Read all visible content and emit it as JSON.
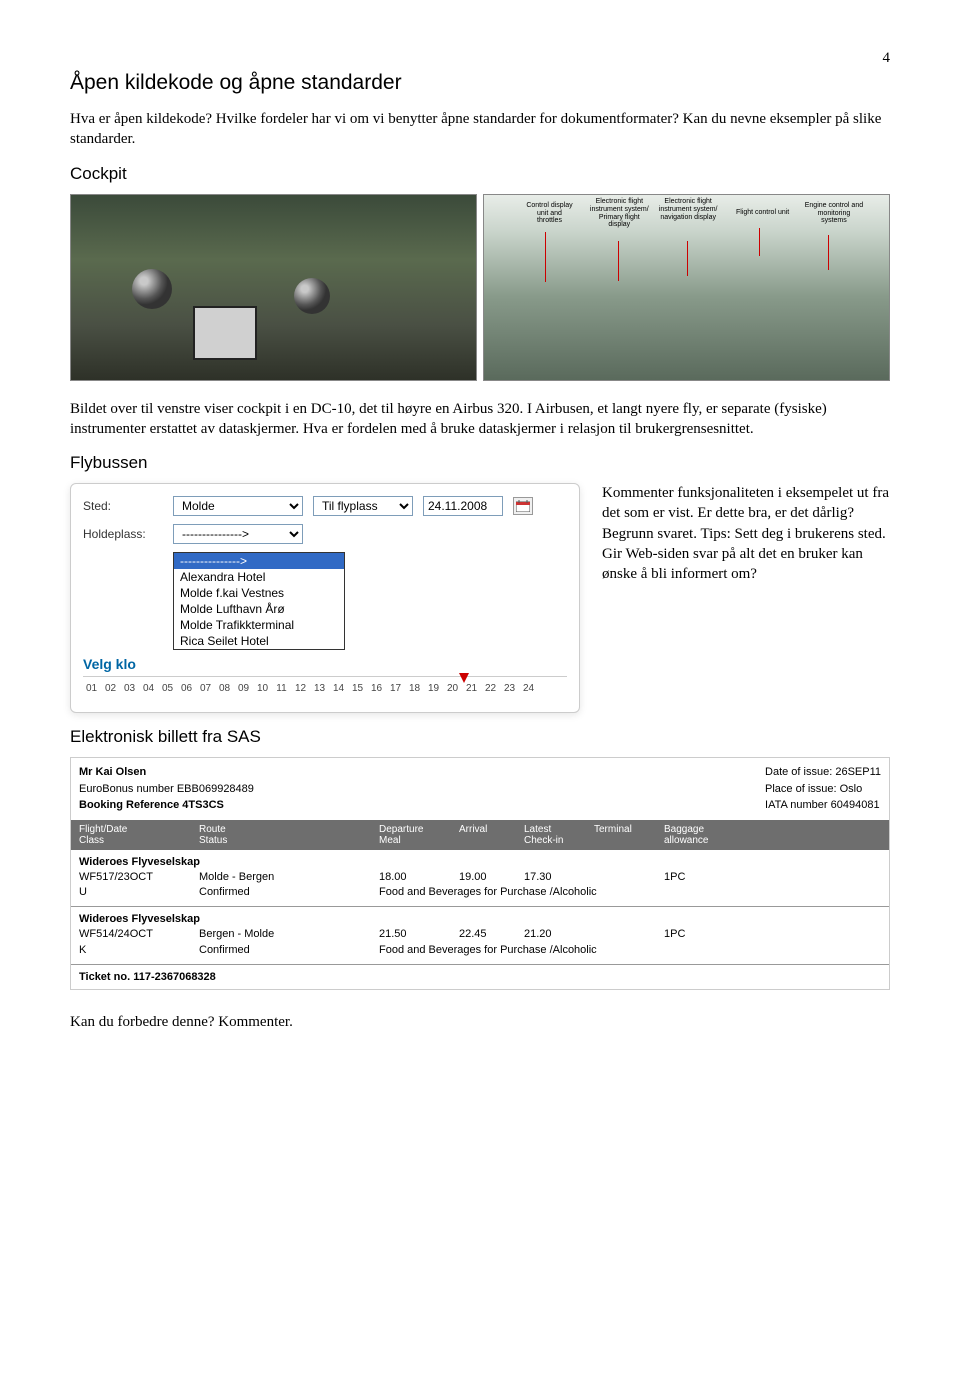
{
  "page_number": "4",
  "h1": "Åpen kildekode og åpne standarder",
  "intro": "Hva er åpen kildekode? Hvilke fordeler har vi om vi benytter åpne standarder for dokumentformater? Kan du nevne eksempler på slike standarder.",
  "h2_cockpit": "Cockpit",
  "a320_labels": {
    "l1": "Control display unit and throttles",
    "l2": "Electronic flight instrument system/ Primary flight display",
    "l3": "Electronic flight instrument system/ navigation display",
    "l4": "Flight control unit",
    "l5": "Engine control and monitoring systems"
  },
  "cockpit_para": "Bildet over til venstre viser cockpit i en DC-10, det til høyre en Airbus 320. I Airbusen, et langt nyere fly, er separate (fysiske) instrumenter erstattet av dataskjermer. Hva er fordelen med å bruke dataskjermer i relasjon til brukergrensesnittet.",
  "h2_flybussen": "Flybussen",
  "flybussen": {
    "sted_label": "Sted:",
    "sted_value": "Molde",
    "direction": "Til flyplass",
    "date": "24.11.2008",
    "holdeplass_label": "Holdeplass:",
    "holdeplass_value": "--------------->",
    "dropdown_blank": "--------------->",
    "options": [
      "Alexandra Hotel",
      "Molde f.kai Vestnes",
      "Molde Lufthavn Årø",
      "Molde Trafikkterminal",
      "Rica Seilet Hotel"
    ],
    "velg": "Velg klo",
    "hours": [
      "01",
      "02",
      "03",
      "04",
      "05",
      "06",
      "07",
      "08",
      "09",
      "10",
      "11",
      "12",
      "13",
      "14",
      "15",
      "16",
      "17",
      "18",
      "19",
      "20",
      "21",
      "22",
      "23",
      "24"
    ]
  },
  "flybussen_comment": "Kommenter funksjonaliteten i eksempelet ut fra det som er vist. Er dette bra, er det dårlig? Begrunn svaret. Tips: Sett deg i brukerens sted. Gir Web-siden svar på alt det en bruker kan ønske å bli informert om?",
  "h2_sas": "Elektronisk billett fra SAS",
  "sas": {
    "name_label": "Mr Kai Olsen",
    "eurobonus": "EuroBonus number EBB069928489",
    "booking": "Booking Reference 4TS3CS",
    "issue_date": "Date of issue: 26SEP11",
    "issue_place": "Place of issue: Oslo",
    "iata": "IATA number 60494081",
    "hdr": {
      "flight1": "Flight/Date",
      "flight2": "Class",
      "route1": "Route",
      "route2": "Status",
      "dep1": "Departure",
      "dep2": "Meal",
      "arr": "Arrival",
      "lat1": "Latest",
      "lat2": "Check-in",
      "term": "Terminal",
      "bag1": "Baggage",
      "bag2": "allowance"
    },
    "seg1": {
      "airline": "Wideroes Flyveselskap",
      "flight": "WF517/23OCT",
      "cls": "U",
      "route": "Molde - Bergen",
      "status": "Confirmed",
      "dep": "18.00",
      "arr": "19.00",
      "lat": "17.30",
      "meal": "Food and Beverages for Purchase /Alcoholic",
      "bag": "1PC"
    },
    "seg2": {
      "airline": "Wideroes Flyveselskap",
      "flight": "WF514/24OCT",
      "cls": "K",
      "route": "Bergen - Molde",
      "status": "Confirmed",
      "dep": "21.50",
      "arr": "22.45",
      "lat": "21.20",
      "meal": "Food and Beverages for Purchase /Alcoholic",
      "bag": "1PC"
    },
    "ticket_no": "Ticket no. 117-2367068328"
  },
  "final_q": "Kan du forbedre denne? Kommenter."
}
